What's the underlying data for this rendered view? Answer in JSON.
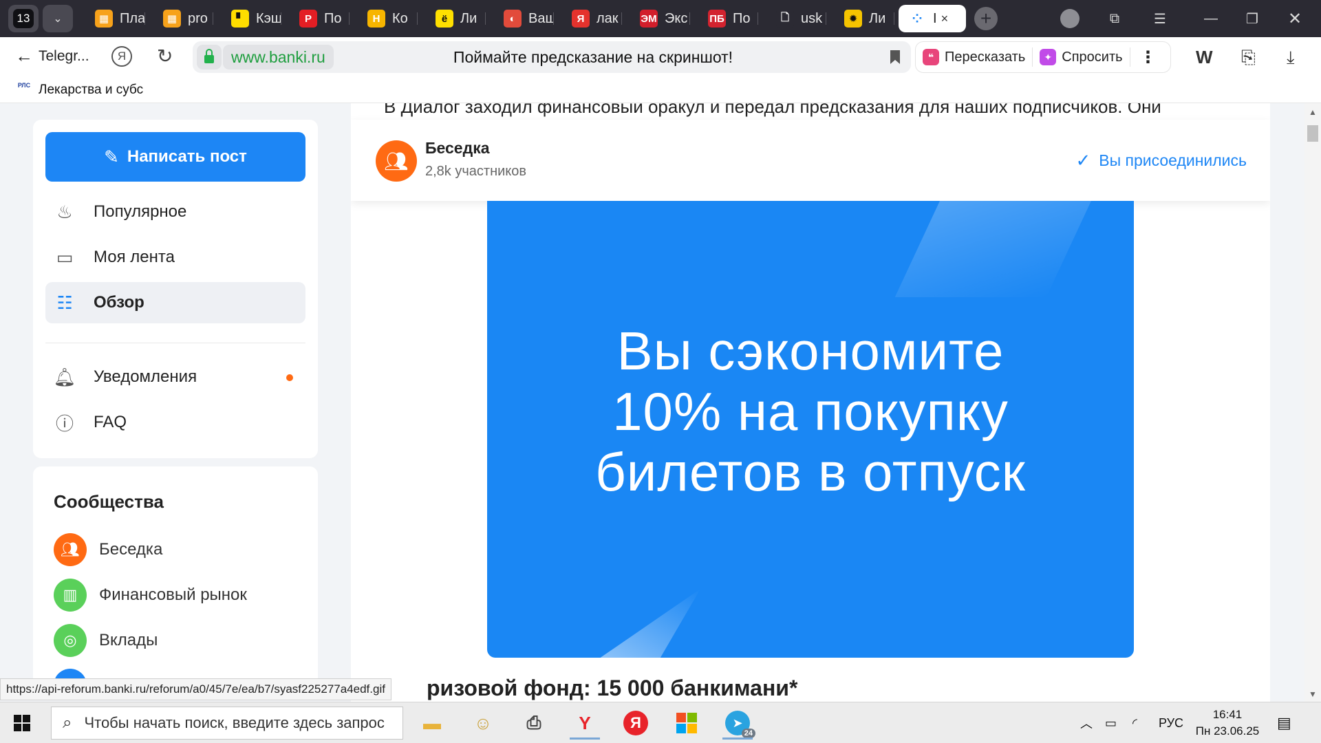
{
  "browser": {
    "tab_count": "13",
    "tabs": [
      {
        "label": "Пла",
        "fav_bg": "#f7a21b",
        "fav": "▦"
      },
      {
        "label": "pro",
        "fav_bg": "#f7a21b",
        "fav": "▦"
      },
      {
        "label": "Кэш",
        "fav_bg": "#ffdd00",
        "fav": "▘"
      },
      {
        "label": "По",
        "fav_bg": "#e31e24",
        "fav": "P"
      },
      {
        "label": "Ко",
        "fav_bg": "#f7b500",
        "fav": "H"
      },
      {
        "label": "Ли",
        "fav_bg": "#ffe000",
        "fav": "ё"
      },
      {
        "label": "Ваш",
        "fav_bg": "#e24b3b",
        "fav": "◐"
      },
      {
        "label": "лак",
        "fav_bg": "#e4322d",
        "fav": "Я"
      },
      {
        "label": "Экс",
        "fav_bg": "#d21e2b",
        "fav": "ЭМ"
      },
      {
        "label": "По",
        "fav_bg": "#d3232f",
        "fav": "ПБ"
      },
      {
        "label": "usk",
        "fav_bg": "#2b2a33",
        "fav": "🗋"
      },
      {
        "label": "Ли",
        "fav_bg": "#f5c400",
        "fav": "✹"
      }
    ],
    "active_tab": {
      "label": "I",
      "close": "×"
    },
    "new_tab": "+",
    "back_label": "Telegr...",
    "url_domain": "www.banki.ru",
    "page_title": "Поймайте предсказание на скриншот!",
    "retell_label": "Пересказать",
    "ask_label": "Спросить",
    "bookmark_label": "Лекарства и субс",
    "bookmark_fav": "РЛС"
  },
  "sidebar": {
    "write_post": "Написать пост",
    "nav": [
      {
        "label": "Популярное",
        "icon": "fire-icon"
      },
      {
        "label": "Моя лента",
        "icon": "feed-icon"
      },
      {
        "label": "Обзор",
        "icon": "explore-icon"
      },
      {
        "label": "Уведомления",
        "icon": "bell-icon"
      },
      {
        "label": "FAQ",
        "icon": "question-icon"
      }
    ],
    "communities_title": "Сообщества",
    "communities": [
      {
        "label": "Беседка",
        "color": "#ff6a13"
      },
      {
        "label": "Финансовый рынок",
        "color": "#5ad05a"
      },
      {
        "label": "Вклады",
        "color": "#5ad05a"
      }
    ]
  },
  "post": {
    "cut_text": "В Диалог заходил финансовый оракул и передал предсказания для наших подписчиков. Они",
    "community_name": "Беседка",
    "community_members": "2,8k участников",
    "joined_label": "Вы присоединились",
    "banner_lines": [
      "Вы сэкономите",
      "10% на покупку",
      "билетов в отпуск"
    ],
    "prize_heading": "ризовой фонд: 15 000 банкимани*"
  },
  "status_url": "https://api-reforum.banki.ru/reforum/a0/45/7e/ea/b7/syasf225277a4edf.gif",
  "taskbar": {
    "search_placeholder": "Чтобы начать поиск, введите здесь запрос",
    "lang": "РУС",
    "time": "16:41",
    "date": "Пн 23.06.25",
    "telegram_badge": "24"
  },
  "colors": {
    "accent": "#1d86f5",
    "banner": "#1a87f4",
    "community_orange": "#ff6a13",
    "secure_green": "#22b14c"
  }
}
